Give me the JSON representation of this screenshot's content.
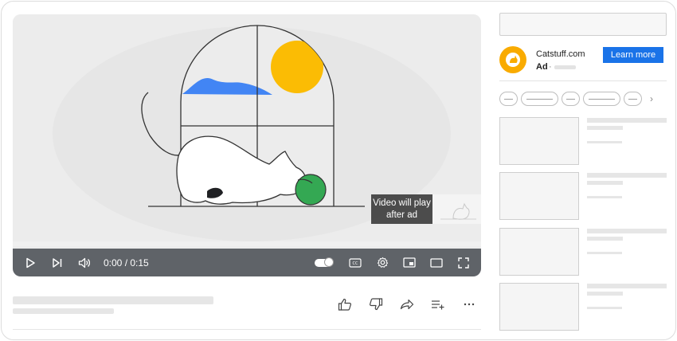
{
  "player": {
    "overlay_text": "Video will play after ad",
    "time_display": "0:00 / 0:15",
    "progress": 0.0,
    "controls": {
      "play": "play-icon",
      "next": "skip-next-icon",
      "volume": "volume-icon",
      "autoplay": "autoplay-toggle-icon",
      "captions": "captions-icon",
      "settings": "gear-icon",
      "miniplayer": "miniplayer-icon",
      "theater": "theater-mode-icon",
      "fullscreen": "fullscreen-icon"
    }
  },
  "actions": {
    "like": "thumbs-up-icon",
    "dislike": "thumbs-down-icon",
    "share": "share-icon",
    "save": "add-to-playlist-icon",
    "more": "more-icon"
  },
  "ad": {
    "domain": "Catstuff.com",
    "label": "Ad",
    "separator": "·",
    "cta": "Learn more"
  },
  "colors": {
    "accent": "#1a73e8",
    "brand": "#f9ab00",
    "control_bar": "#5f6368",
    "sun": "#fbbc04",
    "cloud": "#4285f4",
    "ball": "#34a853"
  }
}
